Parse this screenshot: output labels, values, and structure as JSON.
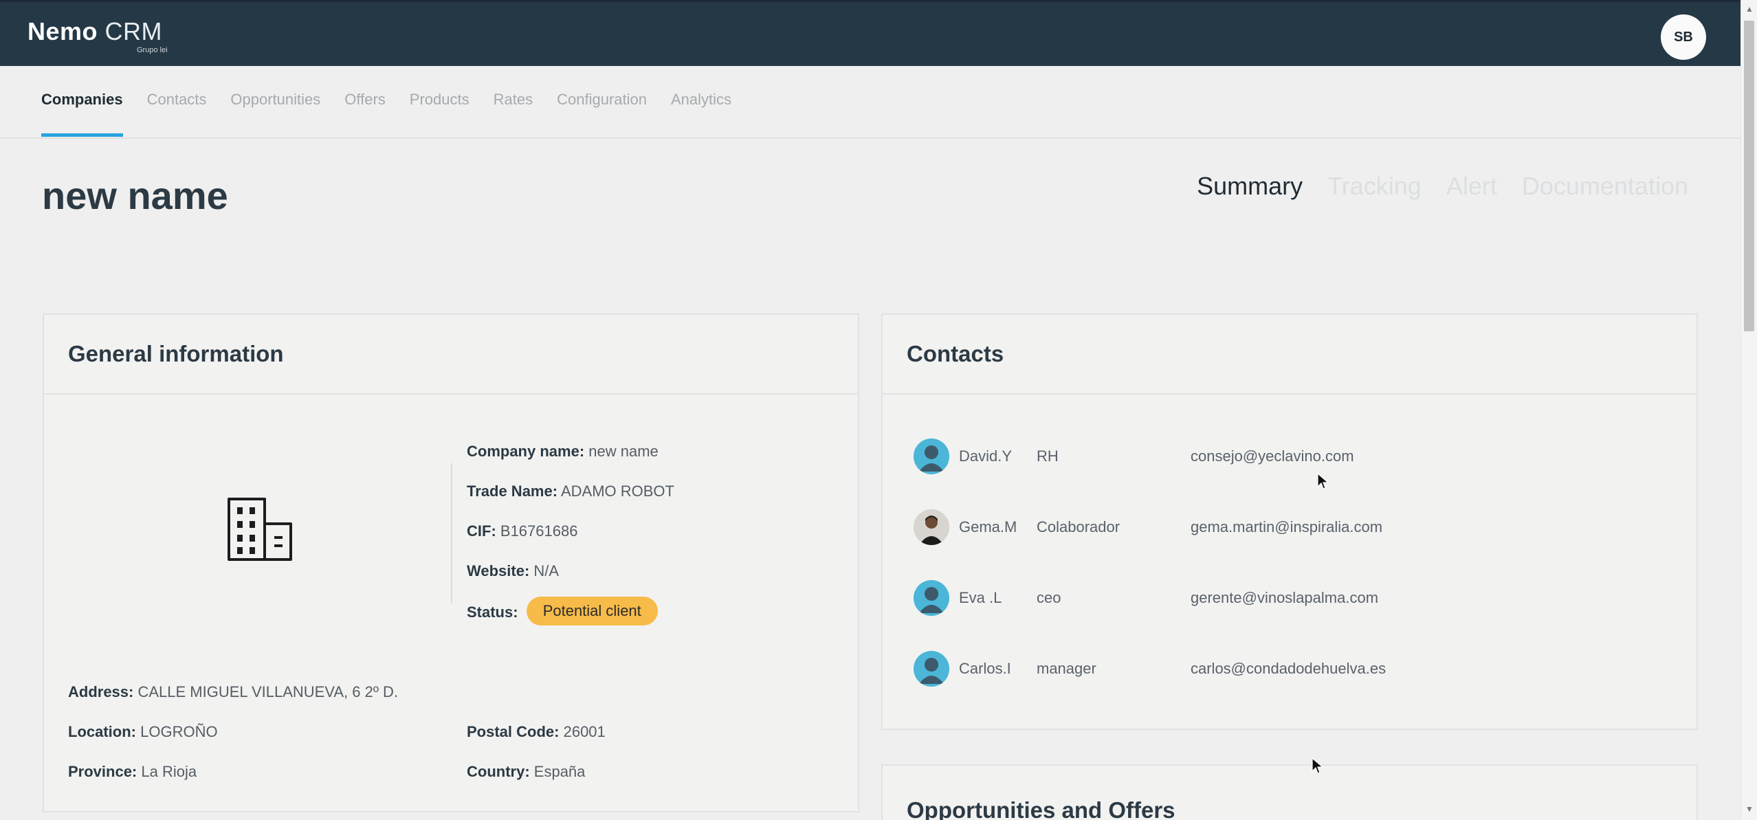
{
  "header": {
    "logo_bold": "Nemo",
    "logo_light": "CRM",
    "logo_sub": "Grupo lei",
    "user_initials": "SB"
  },
  "nav": {
    "tabs": [
      {
        "label": "Companies",
        "active": true
      },
      {
        "label": "Contacts"
      },
      {
        "label": "Opportunities"
      },
      {
        "label": "Offers"
      },
      {
        "label": "Products"
      },
      {
        "label": "Rates"
      },
      {
        "label": "Configuration"
      },
      {
        "label": "Analytics"
      }
    ]
  },
  "page": {
    "title": "new name",
    "subtabs": [
      {
        "label": "Summary",
        "active": true
      },
      {
        "label": "Tracking"
      },
      {
        "label": "Alert"
      },
      {
        "label": "Documentation"
      }
    ]
  },
  "general": {
    "title": "General information",
    "company_name_label": "Company name:",
    "company_name": "new name",
    "trade_name_label": "Trade Name:",
    "trade_name": "ADAMO ROBOT",
    "cif_label": "CIF:",
    "cif": "B16761686",
    "website_label": "Website:",
    "website": "N/A",
    "status_label": "Status:",
    "status": "Potential client",
    "status_color": "#f7bb49",
    "address_label": "Address:",
    "address": "CALLE MIGUEL VILLANUEVA, 6 2º D.",
    "location_label": "Location:",
    "location": "LOGROÑO",
    "postal_label": "Postal Code:",
    "postal": "26001",
    "province_label": "Province:",
    "province": "La Rioja",
    "country_label": "Country:",
    "country": "España"
  },
  "contacts": {
    "title": "Contacts",
    "rows": [
      {
        "name": "David.Y",
        "role": "RH",
        "email": "consejo@yeclavino.com",
        "avatar": "default"
      },
      {
        "name": "Gema.M",
        "role": "Colaborador",
        "email": "gema.martin@inspiralia.com",
        "avatar": "photo"
      },
      {
        "name": "Eva .L",
        "role": "ceo",
        "email": "gerente@vinoslapalma.com",
        "avatar": "default"
      },
      {
        "name": "Carlos.I",
        "role": "manager",
        "email": "carlos@condadodehuelva.es",
        "avatar": "default"
      }
    ]
  },
  "opportunities": {
    "title": "Opportunities and Offers"
  },
  "colors": {
    "header_bg": "#253846",
    "accent": "#29a3df",
    "page_bg": "#efefef"
  }
}
